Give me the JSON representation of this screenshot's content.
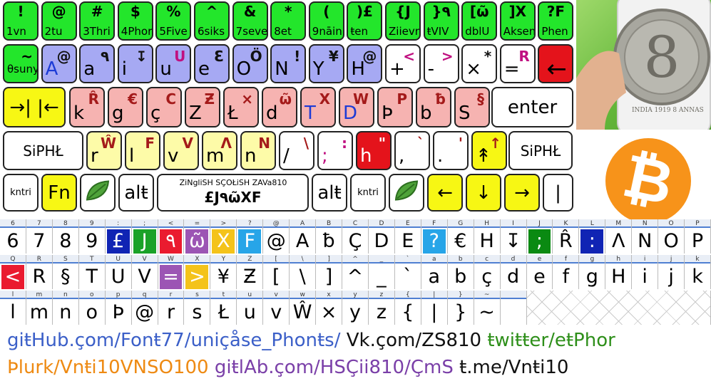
{
  "keyboard": {
    "row1": [
      {
        "sym": "!",
        "sub": "1vn",
        "color": "g"
      },
      {
        "sym": "@",
        "sub": "2tu",
        "color": "g"
      },
      {
        "sym": "#",
        "sub": "3Thri",
        "color": "g"
      },
      {
        "sym": "$",
        "sub": "4Phor",
        "color": "g"
      },
      {
        "sym": "%",
        "sub": "5Five",
        "color": "g"
      },
      {
        "sym": "^",
        "sub": "6siks",
        "color": "g"
      },
      {
        "sym": "&",
        "sub": "7seven",
        "color": "g"
      },
      {
        "sym": "*",
        "sub": "8et",
        "color": "g"
      },
      {
        "sym": "(",
        "sub": "9nāin",
        "color": "g"
      },
      {
        "sym": ")£",
        "sub": "ŧen",
        "color": "g"
      },
      {
        "sym": "{J",
        "sub": "Ziievn",
        "color": "g"
      },
      {
        "sym": "}٩",
        "sub": "ŧVIV",
        "color": "g"
      },
      {
        "sym": "[ῶ",
        "sub": "dblU",
        "color": "g"
      },
      {
        "sym": "]X",
        "sub": "Aksen",
        "color": "g"
      },
      {
        "sym": "?F",
        "sub": "Phen",
        "color": "g"
      }
    ],
    "row2": [
      {
        "alt": "~",
        "main": "θsuny",
        "color": "g"
      },
      {
        "alt": "@",
        "main": "A",
        "color": "b"
      },
      {
        "alt": "٩",
        "main": "a",
        "color": "b"
      },
      {
        "alt": "↧",
        "main": "i",
        "color": "b"
      },
      {
        "alt": "U",
        "main": "u",
        "color": "b"
      },
      {
        "alt": "Ɛ",
        "main": "e",
        "color": "b"
      },
      {
        "alt": "Ö",
        "main": "O",
        "color": "b"
      },
      {
        "alt": "!",
        "main": "N",
        "color": "b"
      },
      {
        "alt": "¥",
        "main": "Y",
        "color": "b"
      },
      {
        "alt": "@",
        "main": "H",
        "color": "b"
      },
      {
        "alt": "<",
        "main": "+",
        "color": "w"
      },
      {
        "alt": ">",
        "main": "-",
        "color": "w"
      },
      {
        "alt": "*",
        "main": "×",
        "color": "w"
      },
      {
        "alt": "R",
        "main": "=",
        "color": "w"
      },
      {
        "alt": "",
        "main": "←",
        "color": "red"
      }
    ],
    "row3": [
      {
        "alt": "",
        "main": "→| |←",
        "color": "yy"
      },
      {
        "alt": "R̂",
        "main": "k",
        "color": "r"
      },
      {
        "alt": "€",
        "main": "g",
        "color": "r"
      },
      {
        "alt": "C",
        "main": "ç",
        "color": "r"
      },
      {
        "alt": "Ƶ",
        "main": "Z",
        "color": "r"
      },
      {
        "alt": "×",
        "main": "Ł",
        "color": "r"
      },
      {
        "alt": "ῶ",
        "main": "d",
        "color": "r"
      },
      {
        "alt": "X",
        "main": "T",
        "color": "r"
      },
      {
        "alt": "W",
        "main": "D",
        "color": "r"
      },
      {
        "alt": "P",
        "main": "Þ",
        "color": "r"
      },
      {
        "alt": "ƀ",
        "main": "b",
        "color": "r"
      },
      {
        "alt": "§",
        "main": "S",
        "color": "r"
      },
      {
        "alt": "",
        "main": "enter",
        "color": "w"
      }
    ],
    "row4": [
      {
        "alt": "",
        "main": "SiPHŁ",
        "color": "w"
      },
      {
        "alt": "Ŵ",
        "main": "r",
        "color": "y"
      },
      {
        "alt": "F",
        "main": "l",
        "color": "y"
      },
      {
        "alt": "V",
        "main": "v",
        "color": "y"
      },
      {
        "alt": "Λ",
        "main": "m",
        "color": "y"
      },
      {
        "alt": "N",
        "main": "n",
        "color": "y"
      },
      {
        "alt": "\\",
        "main": "/",
        "color": "w"
      },
      {
        "alt": ":",
        "main": ";",
        "color": "w"
      },
      {
        "alt": "\"",
        "main": "h",
        "color": "red"
      },
      {
        "alt": "`",
        "main": ",",
        "color": "w"
      },
      {
        "alt": "'",
        "main": ".",
        "color": "w"
      },
      {
        "alt": "↑",
        "main": "↟",
        "color": "yy"
      },
      {
        "alt": "",
        "main": "SiPHŁ",
        "color": "w"
      }
    ],
    "row5": [
      {
        "main": "kntri",
        "color": "w"
      },
      {
        "main": "Fn",
        "color": "yy"
      },
      {
        "main": "",
        "color": "w",
        "icon": "leaf-icon"
      },
      {
        "main": "alŧ",
        "color": "w"
      },
      {
        "main": "£J٩ῶXF",
        "label": "ZiNgliSH SÇOŁiSH ZAVa810",
        "color": "w"
      },
      {
        "main": "alŧ",
        "color": "w"
      },
      {
        "main": "kntri",
        "color": "w"
      },
      {
        "main": "",
        "color": "w",
        "icon": "branch-icon"
      },
      {
        "main": "←",
        "color": "yy"
      },
      {
        "main": "↓",
        "color": "yy"
      },
      {
        "main": "→",
        "color": "yy"
      },
      {
        "main": "|",
        "color": "w"
      }
    ]
  },
  "table": {
    "row1": [
      {
        "code": "6",
        "glyph": "6"
      },
      {
        "code": "7",
        "glyph": "7"
      },
      {
        "code": "8",
        "glyph": "8"
      },
      {
        "code": "9",
        "glyph": "9"
      },
      {
        "code": ":",
        "glyph": "£",
        "bg": "#1024b4",
        "fg": "#ffffff"
      },
      {
        "code": ";",
        "glyph": "J",
        "bg": "#1aa228",
        "fg": "#ffffff"
      },
      {
        "code": "<",
        "glyph": "٩",
        "bg": "#ea1b2f",
        "fg": "#ffffff"
      },
      {
        "code": "=",
        "glyph": "ῶ",
        "bg": "#9c55b4",
        "fg": "#ffffff"
      },
      {
        "code": ">",
        "glyph": "X",
        "bg": "#f4c31a",
        "fg": "#ffffff"
      },
      {
        "code": "?",
        "glyph": "F",
        "bg": "#27a5e8",
        "fg": "#ffffff"
      },
      {
        "code": "@",
        "glyph": "@"
      },
      {
        "code": "A",
        "glyph": "A"
      },
      {
        "code": "B",
        "glyph": "ƀ"
      },
      {
        "code": "C",
        "glyph": "Ç"
      },
      {
        "code": "D",
        "glyph": "D"
      },
      {
        "code": "E",
        "glyph": "E"
      },
      {
        "code": "F",
        "glyph": "?",
        "bg": "#27a5e8",
        "fg": "#ffffff"
      },
      {
        "code": "G",
        "glyph": "€"
      },
      {
        "code": "H",
        "glyph": "H"
      },
      {
        "code": "I",
        "glyph": "↧"
      },
      {
        "code": "J",
        "glyph": ";",
        "bg": "#0a8a12",
        "fg": "#ffffff"
      },
      {
        "code": "K",
        "glyph": "R̂"
      },
      {
        "code": "L",
        "glyph": ":",
        "bg": "#1024b4",
        "fg": "#ffffff"
      },
      {
        "code": "M",
        "glyph": "Λ"
      },
      {
        "code": "N",
        "glyph": "N"
      },
      {
        "code": "O",
        "glyph": "O"
      },
      {
        "code": "P",
        "glyph": "P"
      }
    ],
    "row2": [
      {
        "code": "Q",
        "glyph": "<",
        "bg": "#ea1b2f",
        "fg": "#ffffff"
      },
      {
        "code": "R",
        "glyph": "R"
      },
      {
        "code": "S",
        "glyph": "§"
      },
      {
        "code": "T",
        "glyph": "T"
      },
      {
        "code": "U",
        "glyph": "U"
      },
      {
        "code": "V",
        "glyph": "V"
      },
      {
        "code": "W",
        "glyph": "=",
        "bg": "#9c55b4",
        "fg": "#ffffff"
      },
      {
        "code": "X",
        "glyph": ">",
        "bg": "#f4c31a",
        "fg": "#ffffff"
      },
      {
        "code": "Y",
        "glyph": "¥"
      },
      {
        "code": "Z",
        "glyph": "Ƶ"
      },
      {
        "code": "[",
        "glyph": "["
      },
      {
        "code": "\\",
        "glyph": "\\"
      },
      {
        "code": "]",
        "glyph": "]"
      },
      {
        "code": "^",
        "glyph": "^"
      },
      {
        "code": "_",
        "glyph": "_"
      },
      {
        "code": "`",
        "glyph": "`"
      },
      {
        "code": "a",
        "glyph": "a"
      },
      {
        "code": "b",
        "glyph": "b"
      },
      {
        "code": "c",
        "glyph": "ç"
      },
      {
        "code": "d",
        "glyph": "d"
      },
      {
        "code": "e",
        "glyph": "e"
      },
      {
        "code": "f",
        "glyph": "f"
      },
      {
        "code": "g",
        "glyph": "g"
      },
      {
        "code": "h",
        "glyph": "H"
      },
      {
        "code": "i",
        "glyph": "i"
      },
      {
        "code": "j",
        "glyph": "j"
      },
      {
        "code": "k",
        "glyph": "k"
      }
    ],
    "row3": [
      {
        "code": "l",
        "glyph": "l"
      },
      {
        "code": "m",
        "glyph": "m"
      },
      {
        "code": "n",
        "glyph": "n"
      },
      {
        "code": "o",
        "glyph": "o"
      },
      {
        "code": "p",
        "glyph": "Þ"
      },
      {
        "code": "q",
        "glyph": "@"
      },
      {
        "code": "r",
        "glyph": "r"
      },
      {
        "code": "s",
        "glyph": "s"
      },
      {
        "code": "t",
        "glyph": "Ł"
      },
      {
        "code": "u",
        "glyph": "u"
      },
      {
        "code": "v",
        "glyph": "v"
      },
      {
        "code": "w",
        "glyph": "Ŵ"
      },
      {
        "code": "x",
        "glyph": "×"
      },
      {
        "code": "y",
        "glyph": "y"
      },
      {
        "code": "z",
        "glyph": "z"
      },
      {
        "code": "{",
        "glyph": "{"
      },
      {
        "code": "|",
        "glyph": "|"
      },
      {
        "code": "}",
        "glyph": "}"
      },
      {
        "code": "~",
        "glyph": "~"
      },
      {
        "code": "",
        "glyph": ""
      }
    ]
  },
  "links": {
    "line1": [
      {
        "text": "giŧHub.çom/Fonŧ77/uniçåse_Phonŧs/",
        "color": "#3b5fc8"
      },
      {
        "text": " Vk.çom/ZS810 ",
        "color": "#111111"
      },
      {
        "text": "ŧwiŧŧer/eŧPhor",
        "color": "#2e8f1a"
      }
    ],
    "line2": [
      {
        "text": "Þlurk/Vnŧi10VNSO100 ",
        "color": "#ee8a13"
      },
      {
        "text": "giŧlAb.çom/HSÇii810/ÇmS ",
        "color": "#7a3fa8"
      },
      {
        "text": "ŧ.me/Vnŧi10",
        "color": "#111111"
      }
    ]
  },
  "images": {
    "coin_text": "INDIA 1919 8 ANNAS",
    "bitcoin_symbol": "₿"
  }
}
